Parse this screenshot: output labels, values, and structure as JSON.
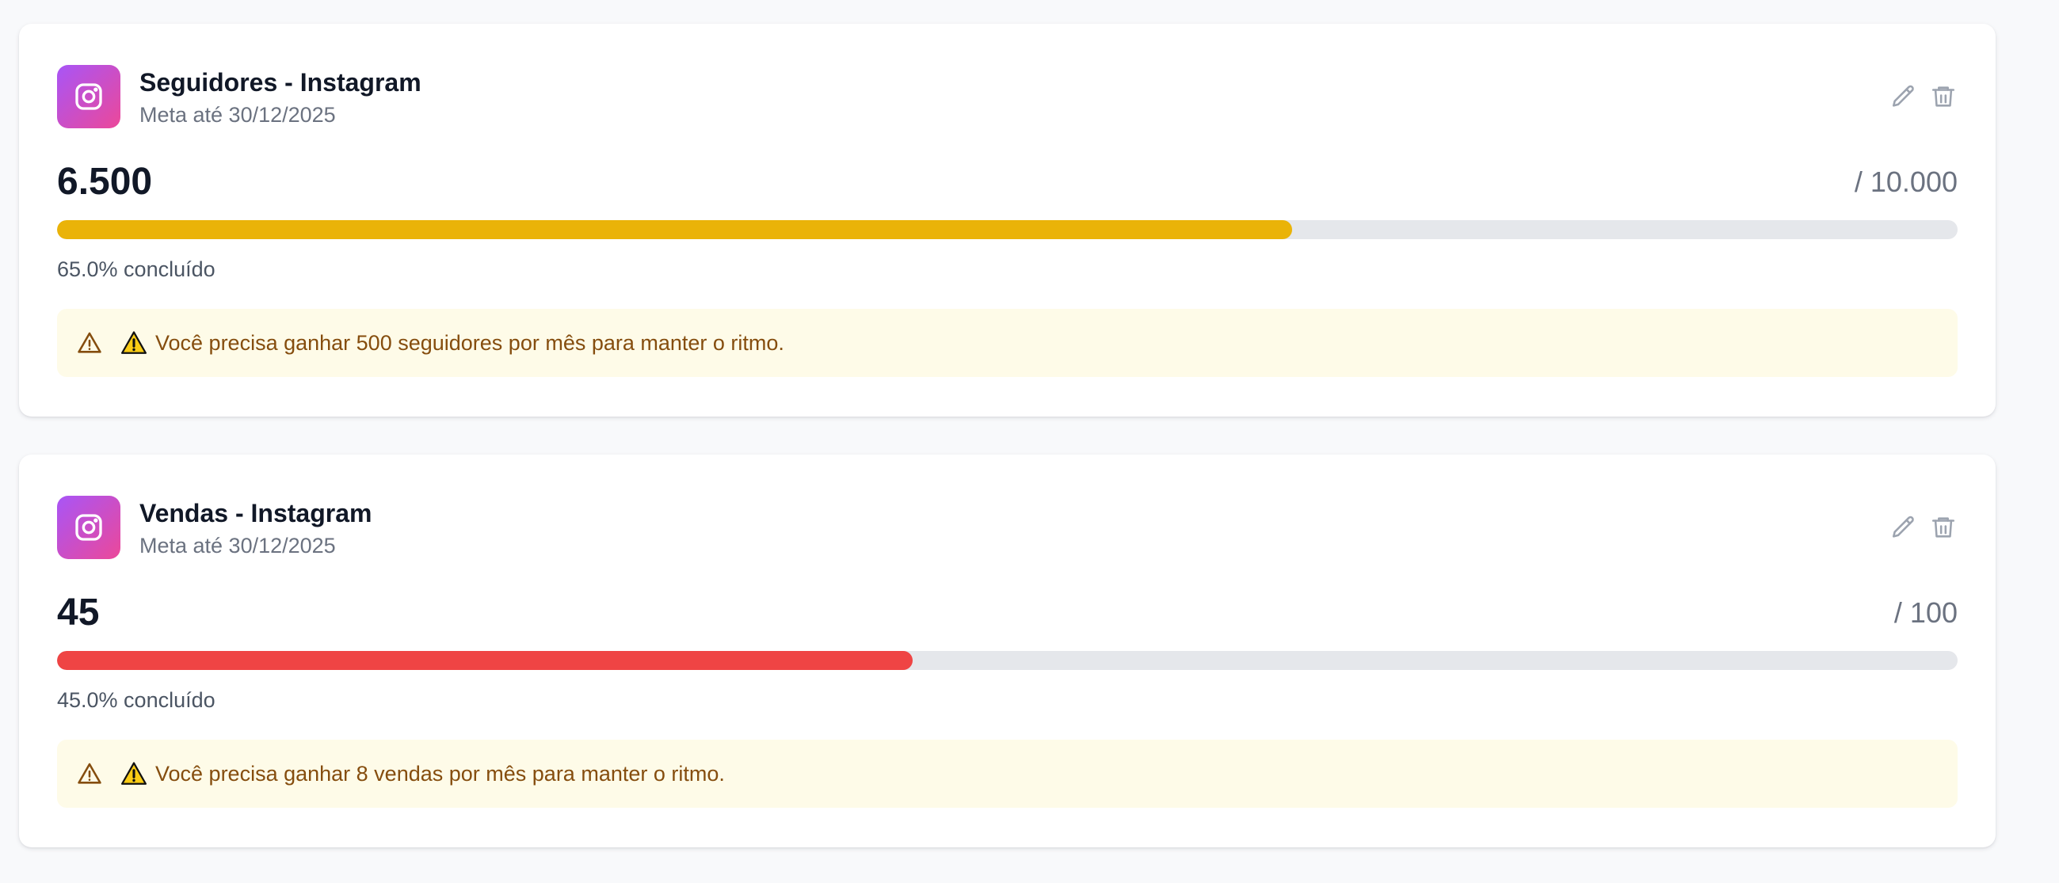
{
  "goals": [
    {
      "title": "Seguidores - Instagram",
      "subtitle": "Meta até 30/12/2025",
      "current": "6.500",
      "target": "/ 10.000",
      "progress_percent": 65.0,
      "percent_label": "65.0% concluído",
      "bar_color": "#eab308",
      "alert_text": "Você precisa ganhar 500 seguidores por mês para manter o ritmo.",
      "icon": "instagram-icon"
    },
    {
      "title": "Vendas - Instagram",
      "subtitle": "Meta até 30/12/2025",
      "current": "45",
      "target": "/ 100",
      "progress_percent": 45.0,
      "percent_label": "45.0% concluído",
      "bar_color": "#ef4444",
      "alert_text": "Você precisa ganhar 8 vendas por mês para manter o ritmo.",
      "icon": "instagram-icon"
    }
  ],
  "colors": {
    "instagram_gradient_start": "#a855f7",
    "instagram_gradient_end": "#ec4899",
    "alert_background": "#fefbe8",
    "alert_text": "#854d0e",
    "track": "#e5e7eb"
  }
}
